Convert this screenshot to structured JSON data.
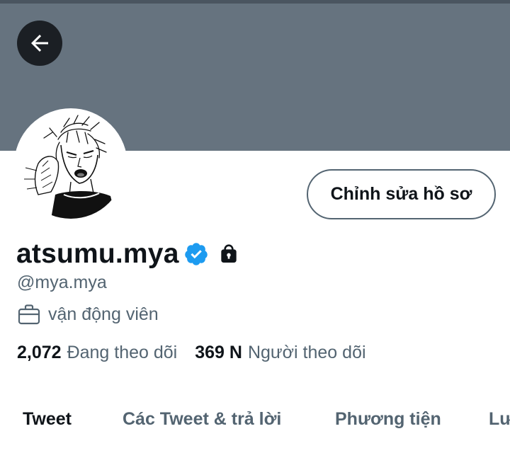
{
  "profile": {
    "display_name": "atsumu.mya",
    "handle": "@mya.mya",
    "bio_category": "vận động viên",
    "verified": true,
    "protected": true,
    "edit_button_label": "Chỉnh sửa hồ sơ"
  },
  "stats": {
    "following_count": "2,072",
    "following_label": "Đang theo dõi",
    "followers_count": "369 N",
    "followers_label": "Người theo dõi"
  },
  "tabs": [
    {
      "label": "Tweet",
      "active": true
    },
    {
      "label": "Các Tweet & trả lời",
      "active": false
    },
    {
      "label": "Phương tiện",
      "active": false
    },
    {
      "label": "Lượt thích",
      "active": false
    }
  ],
  "icons": {
    "back": "arrow-left-icon",
    "verified": "verified-badge-icon",
    "lock": "lock-icon",
    "bio": "briefcase-icon"
  },
  "colors": {
    "banner": "#66737f",
    "verified_blue": "#1d9bf0",
    "text_primary": "#0f1419",
    "text_secondary": "#536471"
  }
}
